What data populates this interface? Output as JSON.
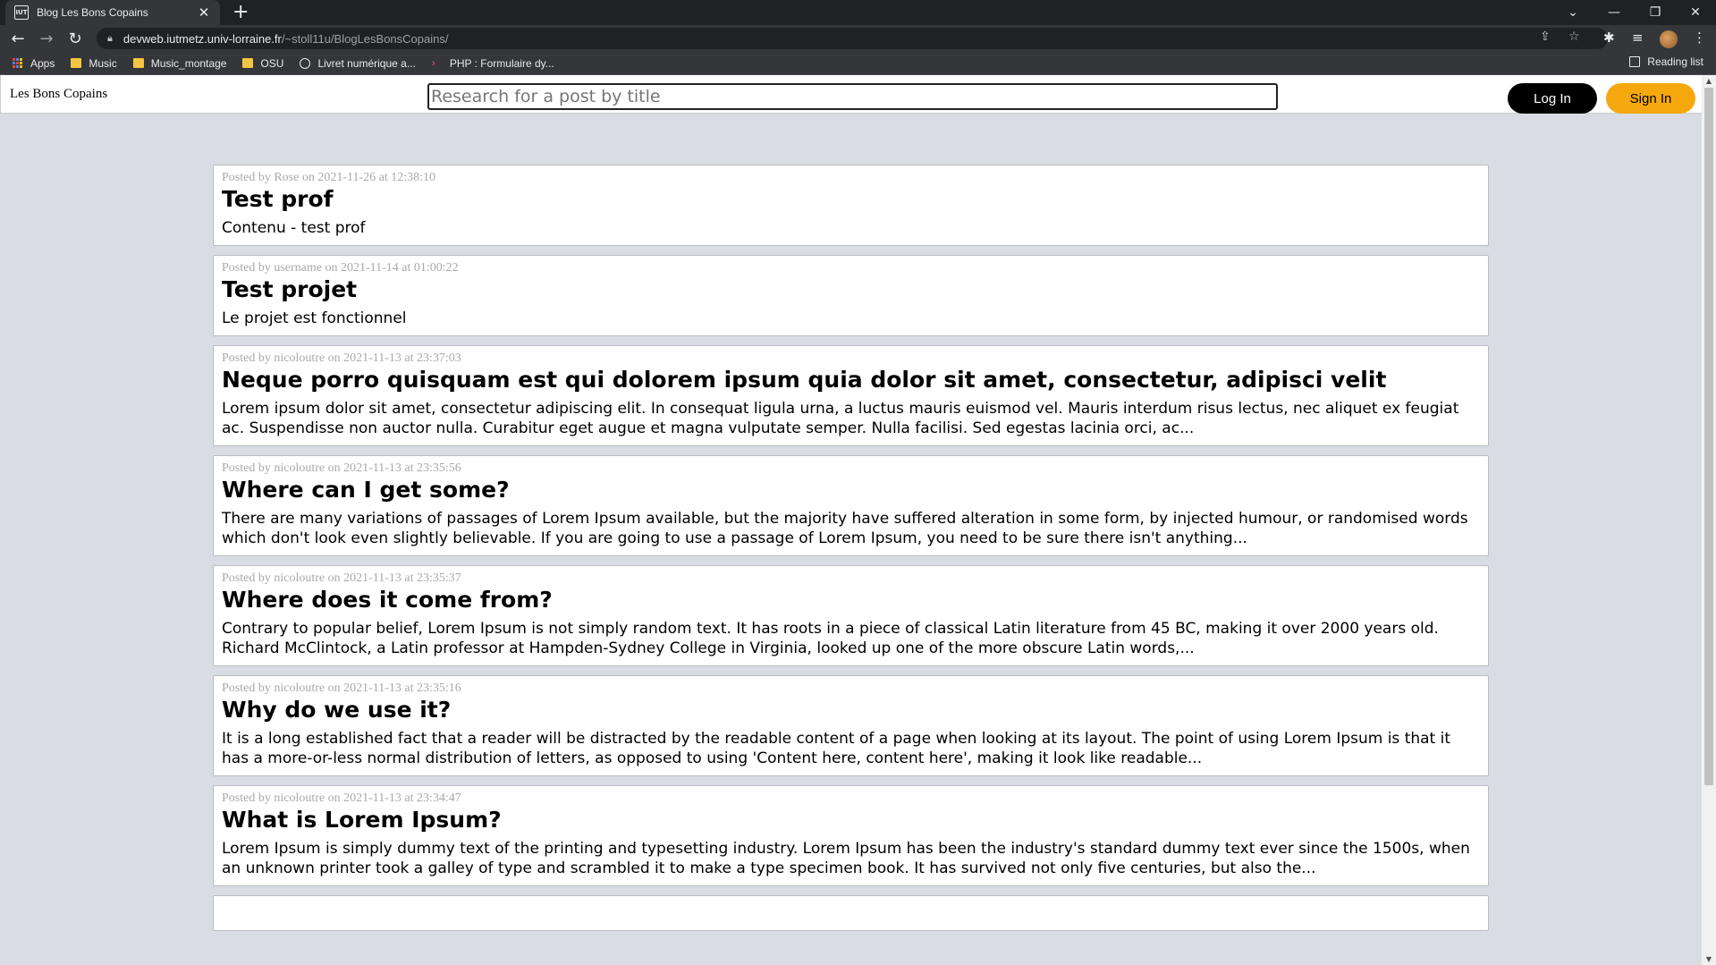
{
  "browser": {
    "tab_title": "Blog Les Bons Copains",
    "tab_favicon": "IUT",
    "url_host": "devweb.iutmetz.univ-lorraine.fr",
    "url_path": "/~stoll11u/BlogLesBonsCopains/",
    "bookmarks": [
      {
        "label": "Apps",
        "icon": "apps-grid-icon"
      },
      {
        "label": "Music",
        "icon": "folder-icon"
      },
      {
        "label": "Music_montage",
        "icon": "folder-icon"
      },
      {
        "label": "OSU",
        "icon": "folder-icon"
      },
      {
        "label": "Livret numérique a...",
        "icon": "globe-icon"
      },
      {
        "label": "PHP : Formulaire dy...",
        "icon": "php-icon"
      }
    ],
    "reading_list": "Reading list"
  },
  "header": {
    "brand": "Les Bons Copains",
    "search_placeholder": "Research for a post by title",
    "login_label": "Log In",
    "signin_label": "Sign In",
    "signin_color": "#f5a80e"
  },
  "posts": [
    {
      "meta": "Posted by Rose on 2021-11-26 at 12:38:10",
      "title": "Test prof",
      "body": "Contenu - test prof"
    },
    {
      "meta": "Posted by username on 2021-11-14 at 01:00:22",
      "title": "Test projet",
      "body": "Le projet est fonctionnel"
    },
    {
      "meta": "Posted by nicoloutre on 2021-11-13 at 23:37:03",
      "title": "Neque porro quisquam est qui dolorem ipsum quia dolor sit amet, consectetur, adipisci velit",
      "body": "Lorem ipsum dolor sit amet, consectetur adipiscing elit. In consequat ligula urna, a luctus mauris euismod vel. Mauris interdum risus lectus, nec aliquet ex feugiat ac. Suspendisse non auctor nulla. Curabitur eget augue et magna vulputate semper. Nulla facilisi. Sed egestas lacinia orci, ac..."
    },
    {
      "meta": "Posted by nicoloutre on 2021-11-13 at 23:35:56",
      "title": "Where can I get some?",
      "body": "There are many variations of passages of Lorem Ipsum available, but the majority have suffered alteration in some form, by injected humour, or randomised words which don't look even slightly believable. If you are going to use a passage of Lorem Ipsum, you need to be sure there isn't anything..."
    },
    {
      "meta": "Posted by nicoloutre on 2021-11-13 at 23:35:37",
      "title": "Where does it come from?",
      "body": "Contrary to popular belief, Lorem Ipsum is not simply random text. It has roots in a piece of classical Latin literature from 45 BC, making it over 2000 years old. Richard McClintock, a Latin professor at Hampden-Sydney College in Virginia, looked up one of the more obscure Latin words,..."
    },
    {
      "meta": "Posted by nicoloutre on 2021-11-13 at 23:35:16",
      "title": "Why do we use it?",
      "body": "It is a long established fact that a reader will be distracted by the readable content of a page when looking at its layout. The point of using Lorem Ipsum is that it has a more-or-less normal distribution of letters, as opposed to using 'Content here, content here', making it look like readable..."
    },
    {
      "meta": "Posted by nicoloutre on 2021-11-13 at 23:34:47",
      "title": "What is Lorem Ipsum?",
      "body": "Lorem Ipsum is simply dummy text of the printing and typesetting industry. Lorem Ipsum has been the industry's standard dummy text ever since the 1500s, when an unknown printer took a galley of type and scrambled it to make a type specimen book. It has survived not only five centuries, but also the..."
    }
  ]
}
